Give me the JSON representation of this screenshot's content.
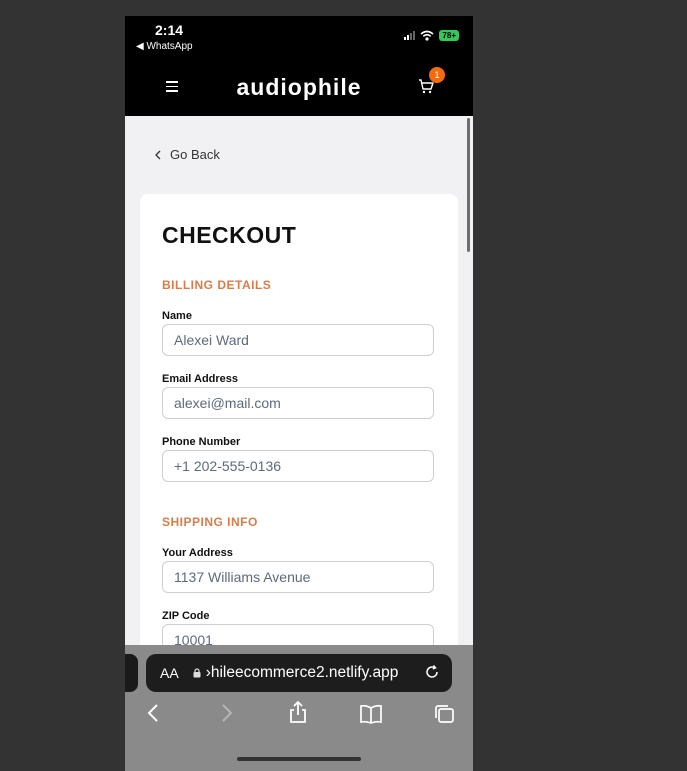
{
  "status_bar": {
    "time": "2:14",
    "back_app": "◀ WhatsApp",
    "battery": "78+"
  },
  "header": {
    "logo": "audiophile",
    "cart_count": "1"
  },
  "nav": {
    "go_back": "Go Back"
  },
  "checkout": {
    "title": "CHECKOUT",
    "billing": {
      "heading": "BILLING DETAILS",
      "name_label": "Name",
      "name_value": "Alexei Ward",
      "email_label": "Email Address",
      "email_value": "alexei@mail.com",
      "phone_label": "Phone Number",
      "phone_value": "+1 202-555-0136"
    },
    "shipping": {
      "heading": "SHIPPING INFO",
      "address_label": "Your Address",
      "address_value": "1137 Williams Avenue",
      "zip_label": "ZIP Code",
      "zip_value": "10001"
    }
  },
  "browser": {
    "text_size": "AA",
    "url": "›hileecommerce2.netlify.app"
  },
  "colors": {
    "accent": "#d87d4a",
    "badge": "#f46b10",
    "header_bg": "#000000"
  }
}
